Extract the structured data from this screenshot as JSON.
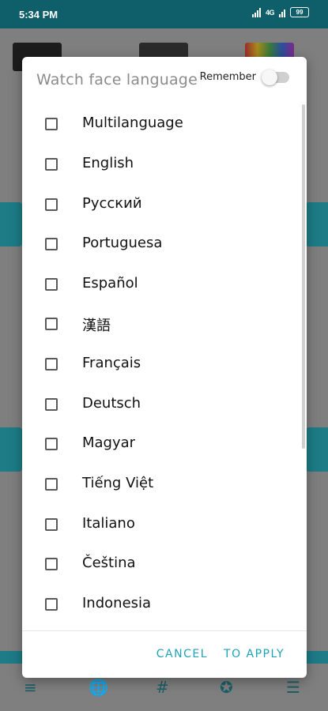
{
  "status_bar": {
    "time": "5:34 PM",
    "network": "4G",
    "battery": "99"
  },
  "dialog": {
    "title": "Watch face language",
    "remember_label": "Remember",
    "remember_on": false,
    "languages": [
      {
        "label": "Multilanguage",
        "checked": false
      },
      {
        "label": "English",
        "checked": false
      },
      {
        "label": "Русский",
        "checked": false
      },
      {
        "label": "Portuguesa",
        "checked": false
      },
      {
        "label": "Español",
        "checked": false
      },
      {
        "label": "漢語",
        "checked": false
      },
      {
        "label": "Français",
        "checked": false
      },
      {
        "label": "Deutsch",
        "checked": false
      },
      {
        "label": "Magyar",
        "checked": false
      },
      {
        "label": "Tiếng Việt",
        "checked": false
      },
      {
        "label": "Italiano",
        "checked": false
      },
      {
        "label": "Čeština",
        "checked": false
      },
      {
        "label": "Indonesia",
        "checked": false
      }
    ],
    "cancel_label": "CANCEL",
    "apply_label": "TO APPLY"
  },
  "colors": {
    "accent": "#1fa3b6",
    "status_bar": "#0e5f6a",
    "title_gray": "#8c8c8c"
  },
  "bottom_nav": {
    "icons": [
      "sort-icon",
      "globe-icon",
      "hashtag-icon",
      "star-badge-icon",
      "menu-icon"
    ]
  }
}
